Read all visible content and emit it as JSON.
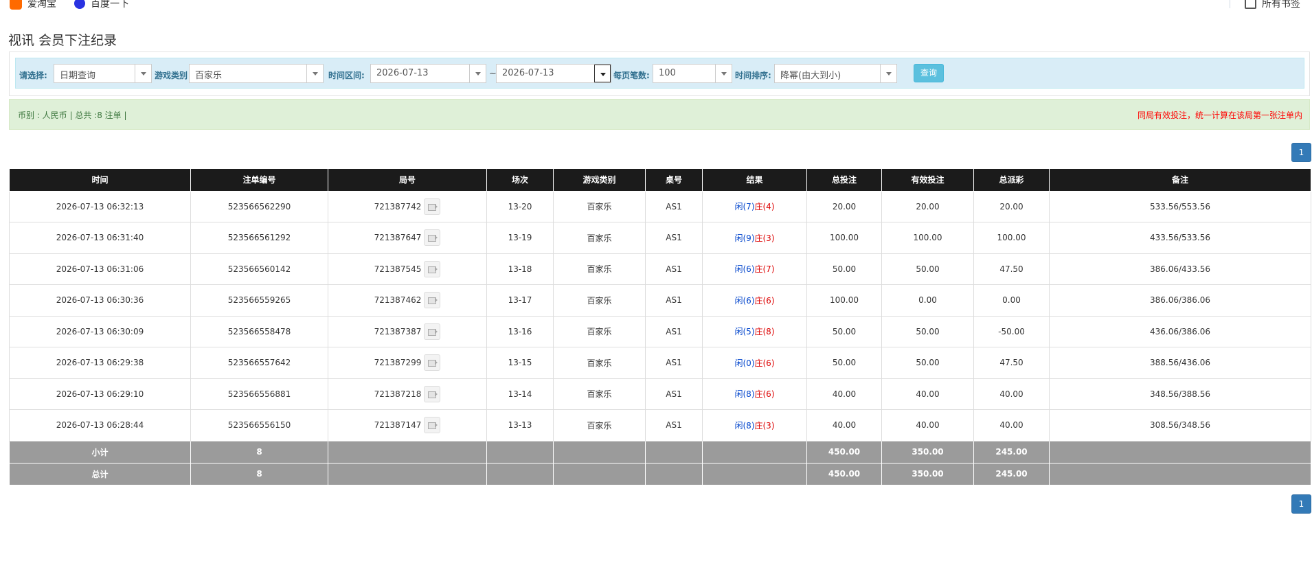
{
  "bookmarks": {
    "taobao": "爱淘宝",
    "baidu": "百度一下",
    "all": "所有书签"
  },
  "page_title": "视讯 会员下注纪录",
  "filters": {
    "select_label": "请选择:",
    "date_mode": "日期查询",
    "game_type_label": "游戏类别",
    "game_type": "百家乐",
    "time_range_label": "时间区间:",
    "date_from": "2026-07-13",
    "tilde": "~",
    "date_to": "2026-07-13",
    "per_page_label": "每页笔数:",
    "per_page": "100",
    "sort_label": "时间排序:",
    "sort": "降幂(由大到小)",
    "query_button": "查询"
  },
  "info": {
    "left": "币别 : 人民币 | 总共 :8 注单 |",
    "right": "同局有效投注，统一计算在该局第一张注单内"
  },
  "pagination": {
    "page": "1"
  },
  "table": {
    "headers": [
      "时间",
      "注单编号",
      "局号",
      "场次",
      "游戏类别",
      "桌号",
      "结果",
      "总投注",
      "有效投注",
      "总派彩",
      "备注"
    ],
    "rows": [
      {
        "time": "2026-07-13 06:32:13",
        "bet_id": "523566562290",
        "round": "721387742",
        "shoe": "13-20",
        "game": "百家乐",
        "table": "AS1",
        "player": "闲(7)",
        "banker": "庄(4)",
        "total": "20.00",
        "valid": "20.00",
        "payout": "20.00",
        "remark": "533.56/553.56"
      },
      {
        "time": "2026-07-13 06:31:40",
        "bet_id": "523566561292",
        "round": "721387647",
        "shoe": "13-19",
        "game": "百家乐",
        "table": "AS1",
        "player": "闲(9)",
        "banker": "庄(3)",
        "total": "100.00",
        "valid": "100.00",
        "payout": "100.00",
        "remark": "433.56/533.56"
      },
      {
        "time": "2026-07-13 06:31:06",
        "bet_id": "523566560142",
        "round": "721387545",
        "shoe": "13-18",
        "game": "百家乐",
        "table": "AS1",
        "player": "闲(6)",
        "banker": "庄(7)",
        "total": "50.00",
        "valid": "50.00",
        "payout": "47.50",
        "remark": "386.06/433.56"
      },
      {
        "time": "2026-07-13 06:30:36",
        "bet_id": "523566559265",
        "round": "721387462",
        "shoe": "13-17",
        "game": "百家乐",
        "table": "AS1",
        "player": "闲(6)",
        "banker": "庄(6)",
        "total": "100.00",
        "valid": "0.00",
        "payout": "0.00",
        "remark": "386.06/386.06"
      },
      {
        "time": "2026-07-13 06:30:09",
        "bet_id": "523566558478",
        "round": "721387387",
        "shoe": "13-16",
        "game": "百家乐",
        "table": "AS1",
        "player": "闲(5)",
        "banker": "庄(8)",
        "total": "50.00",
        "valid": "50.00",
        "payout": "-50.00",
        "remark": "436.06/386.06"
      },
      {
        "time": "2026-07-13 06:29:38",
        "bet_id": "523566557642",
        "round": "721387299",
        "shoe": "13-15",
        "game": "百家乐",
        "table": "AS1",
        "player": "闲(0)",
        "banker": "庄(6)",
        "total": "50.00",
        "valid": "50.00",
        "payout": "47.50",
        "remark": "388.56/436.06"
      },
      {
        "time": "2026-07-13 06:29:10",
        "bet_id": "523566556881",
        "round": "721387218",
        "shoe": "13-14",
        "game": "百家乐",
        "table": "AS1",
        "player": "闲(8)",
        "banker": "庄(6)",
        "total": "40.00",
        "valid": "40.00",
        "payout": "40.00",
        "remark": "348.56/388.56"
      },
      {
        "time": "2026-07-13 06:28:44",
        "bet_id": "523566556150",
        "round": "721387147",
        "shoe": "13-13",
        "game": "百家乐",
        "table": "AS1",
        "player": "闲(8)",
        "banker": "庄(3)",
        "total": "40.00",
        "valid": "40.00",
        "payout": "40.00",
        "remark": "308.56/348.56"
      }
    ],
    "subtotal": {
      "label": "小计",
      "count": "8",
      "total": "450.00",
      "valid": "350.00",
      "payout": "245.00"
    },
    "grand_total": {
      "label": "总计",
      "count": "8",
      "total": "450.00",
      "valid": "350.00",
      "payout": "245.00"
    }
  },
  "colors": {
    "header_bg": "#1b1b1b",
    "sum_row_bg": "#9b9b9b",
    "filter_bg": "#d9edf7",
    "info_bg": "#dff0d8",
    "link_blue": "#0044cc",
    "negative_red": "#ff0000",
    "pager_blue": "#337ab7"
  }
}
